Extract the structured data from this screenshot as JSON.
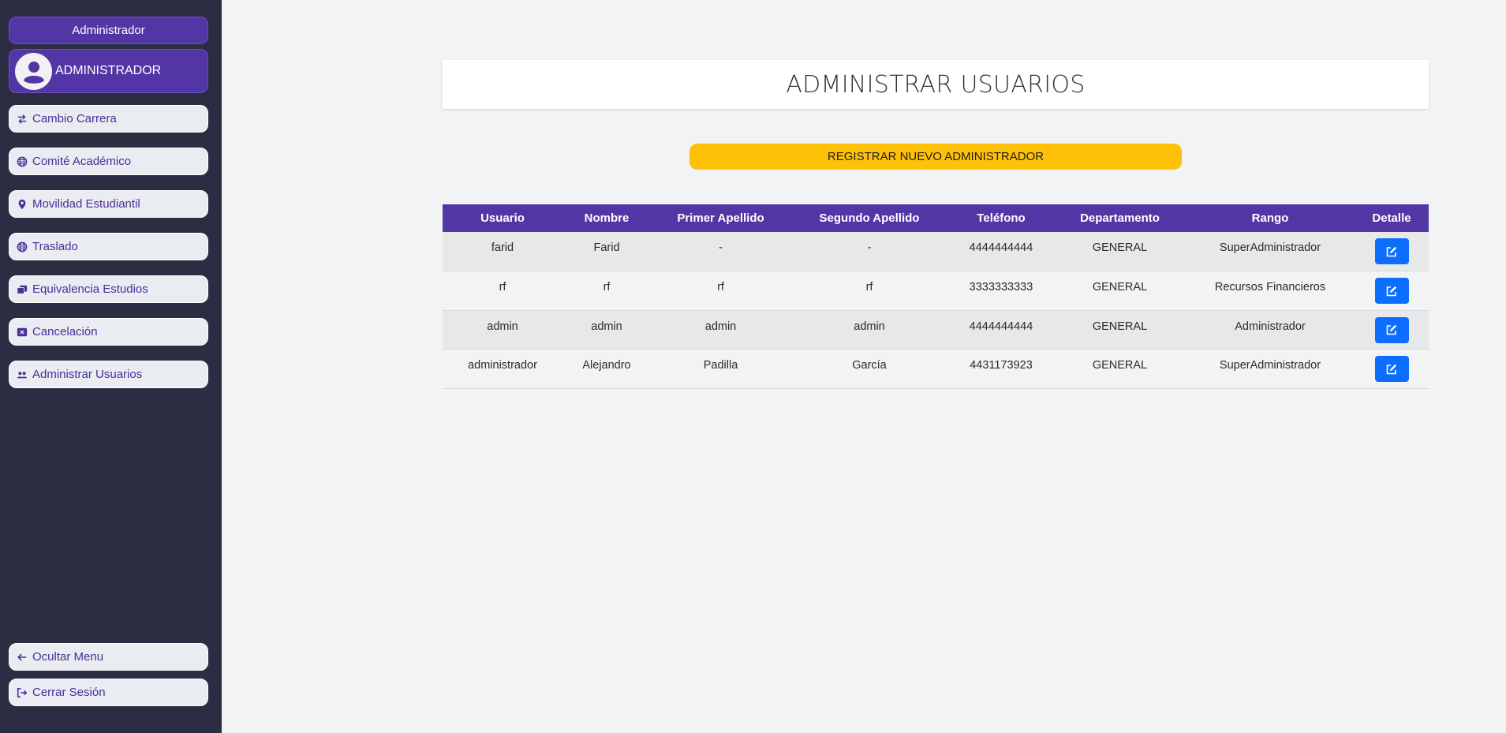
{
  "sidebar": {
    "role_label": "Administrador",
    "user_name": "ADMINISTRADOR",
    "items": [
      {
        "label": "Cambio Carrera",
        "icon": "exchange-icon"
      },
      {
        "label": "Comité Académico",
        "icon": "globe-icon"
      },
      {
        "label": "Movilidad Estudiantil",
        "icon": "map-pin-icon"
      },
      {
        "label": "Traslado",
        "icon": "globe-icon"
      },
      {
        "label": "Equivalencia Estudios",
        "icon": "copy-icon"
      },
      {
        "label": "Cancelación",
        "icon": "x-square-icon"
      },
      {
        "label": "Administrar Usuarios",
        "icon": "users-icon"
      }
    ],
    "bottom": [
      {
        "label": "Ocultar Menu",
        "icon": "arrow-left-icon"
      },
      {
        "label": "Cerrar Sesión",
        "icon": "sign-out-icon"
      }
    ]
  },
  "main": {
    "title": "ADMINISTRAR USUARIOS",
    "register_button": "REGISTRAR NUEVO ADMINISTRADOR",
    "table": {
      "headers": [
        "Usuario",
        "Nombre",
        "Primer Apellido",
        "Segundo Apellido",
        "Teléfono",
        "Departamento",
        "Rango",
        "Detalle"
      ],
      "rows": [
        [
          "farid",
          "Farid",
          "-",
          "-",
          "4444444444",
          "GENERAL",
          "SuperAdministrador"
        ],
        [
          "rf",
          "rf",
          "rf",
          "rf",
          "3333333333",
          "GENERAL",
          "Recursos Financieros"
        ],
        [
          "admin",
          "admin",
          "admin",
          "admin",
          "4444444444",
          "GENERAL",
          "Administrador"
        ],
        [
          "administrador",
          "Alejandro",
          "Padilla",
          "García",
          "4431173923",
          "GENERAL",
          "SuperAdministrador"
        ]
      ]
    }
  },
  "colors": {
    "sidebar_bg": "#2b2d42",
    "accent_purple": "#5336a6",
    "register_yellow": "#ffc107",
    "edit_blue": "#0d6efd"
  }
}
